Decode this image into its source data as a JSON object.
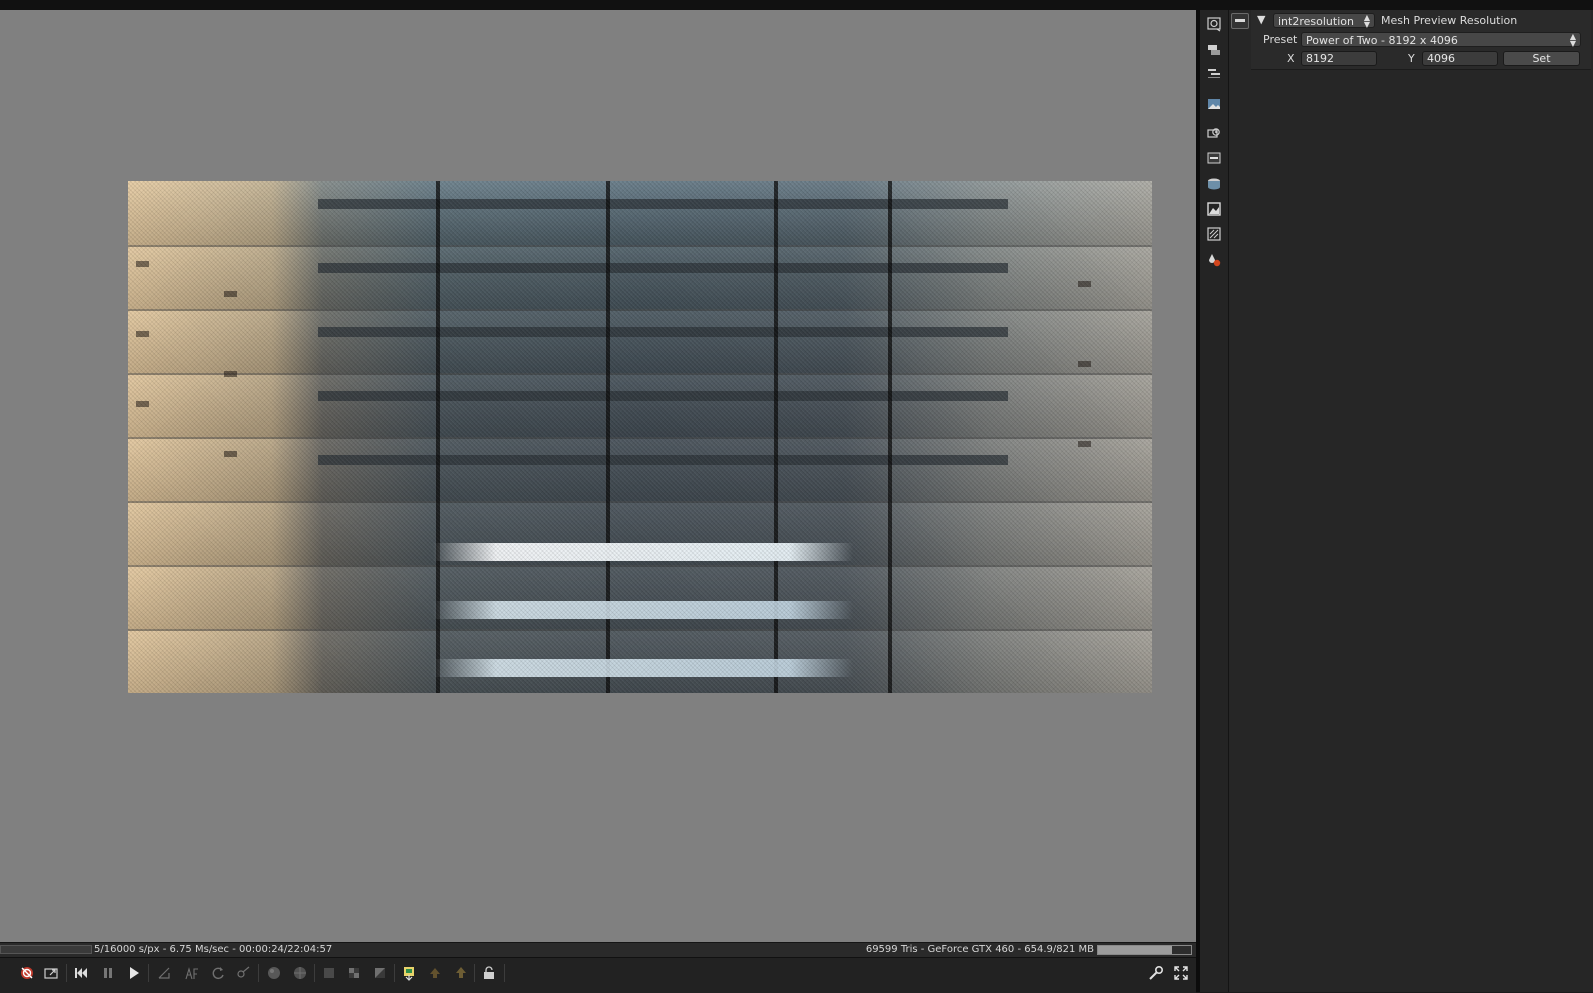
{
  "plugin": {
    "dropdown_value": "int2resolution",
    "title": "Mesh Preview Resolution",
    "preset_label": "Preset",
    "preset_value": "Power of Two - 8192 x 4096",
    "x_label": "X",
    "x_value": "8192",
    "y_label": "Y",
    "y_value": "4096",
    "set_label": "Set"
  },
  "status": {
    "left_text": "5/16000 s/px - 6.75 Ms/sec - 00:00:24/22:04:57",
    "right_text": "69599 Tris - GeForce GTX 460 - 654.9/821 MB",
    "gpu_memory_fraction": 0.8
  },
  "tools": [
    "render-settings-icon",
    "layers-icon",
    "nodes-icon",
    "image-icon",
    "camera-icon",
    "panel-icon",
    "environment-icon",
    "imager-icon",
    "post-process-icon",
    "materials-icon"
  ],
  "toolbar": [
    "reset-icon",
    "fit-icon",
    "rewind-icon",
    "pause-icon",
    "play-icon",
    "region-icon",
    "af-icon",
    "refresh-icon",
    "pick-icon",
    "object-icon",
    "world-icon",
    "checker-icon",
    "alpha-icon",
    "clay-icon",
    "export-icon",
    "lock-icon",
    "settings-wrench-icon",
    "fullscreen-icon"
  ],
  "colors": {
    "viewport_bg": "#808080",
    "panel_bg": "#262626",
    "toolbar_bg": "#222222"
  }
}
